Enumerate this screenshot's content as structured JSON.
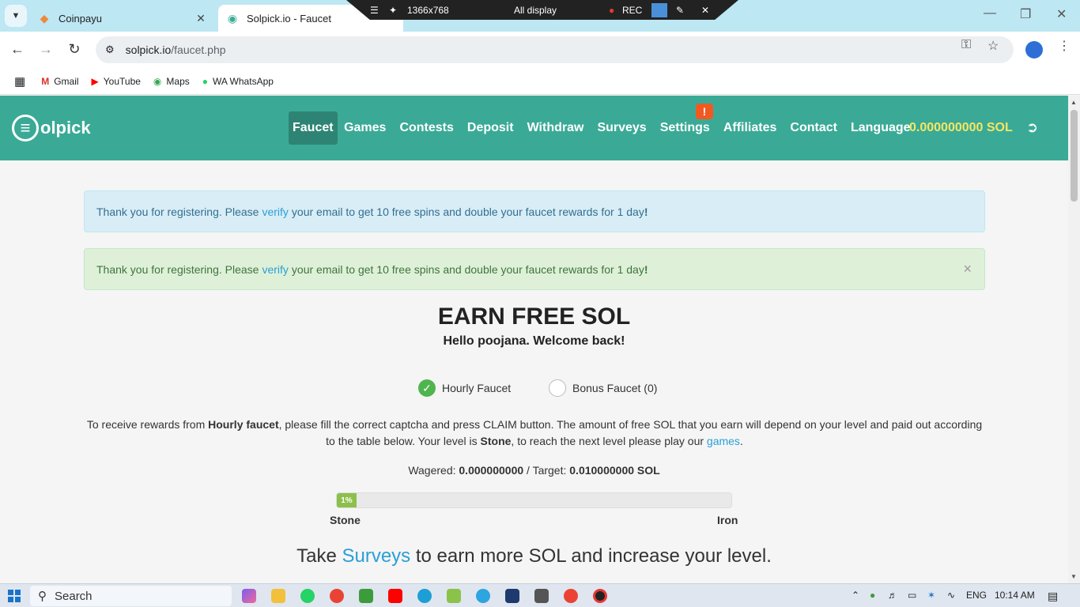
{
  "browser": {
    "tabs": [
      {
        "title": "Coinpayu",
        "active": false
      },
      {
        "title": "Solpick.io - Faucet",
        "active": true
      }
    ],
    "recorder": {
      "resolution": "1366x768",
      "mode": "All display",
      "rec_label": "REC"
    },
    "url_site": "solpick.io",
    "url_path": "/faucet.php",
    "bookmarks": [
      {
        "label": "Gmail",
        "icon": "gmail-icon"
      },
      {
        "label": "YouTube",
        "icon": "youtube-icon"
      },
      {
        "label": "Maps",
        "icon": "maps-icon"
      },
      {
        "label": "WA WhatsApp",
        "icon": "whatsapp-icon"
      }
    ]
  },
  "site": {
    "logo_text": "olpick",
    "menu": [
      "Faucet",
      "Games",
      "Contests",
      "Deposit",
      "Withdraw",
      "Surveys",
      "Settings",
      "Affiliates",
      "Contact",
      "Language"
    ],
    "settings_badge": "!",
    "balance": "0.000000000 SOL",
    "accent_color": "#3aaa96"
  },
  "alerts": {
    "info": {
      "pre": "Thank you for registering. Please",
      "link": "verify",
      "post": "your email to get 10 free spins and double your faucet rewards for 1 day",
      "bang": "!"
    },
    "success": {
      "pre": "Thank you for registering. Please",
      "link": "verify",
      "post": "your email to get 10 free spins and double your faucet rewards for 1 day",
      "bang": "!",
      "close": "×"
    }
  },
  "main": {
    "title": "EARN FREE SOL",
    "welcome": "Hello poojana. Welcome back!",
    "faucet_options": [
      {
        "label": "Hourly Faucet",
        "selected": true
      },
      {
        "label": "Bonus Faucet (0)",
        "selected": false
      }
    ],
    "instructions": {
      "t1": "To receive rewards from ",
      "b1": "Hourly faucet",
      "t2": ", please fill the correct captcha and press CLAIM button. The amount of free SOL that you earn will depend on your level and paid out according to the table below. Your level is ",
      "b2": "Stone",
      "t3": ", to reach the next level please play our ",
      "link": "games",
      "t4": "."
    },
    "wager": {
      "label1": "Wagered: ",
      "wagered": "0.000000000",
      "sep": " / Target: ",
      "target": "0.010000000 SOL"
    },
    "progress": {
      "percent": 1,
      "label": "1%"
    },
    "level_current": "Stone",
    "level_next": "Iron",
    "surveys": {
      "pre": "Take ",
      "link": "Surveys",
      "post": " to earn more SOL and increase your level."
    }
  },
  "taskbar": {
    "search": "Search",
    "language": "ENG",
    "time": "10:14 AM"
  }
}
